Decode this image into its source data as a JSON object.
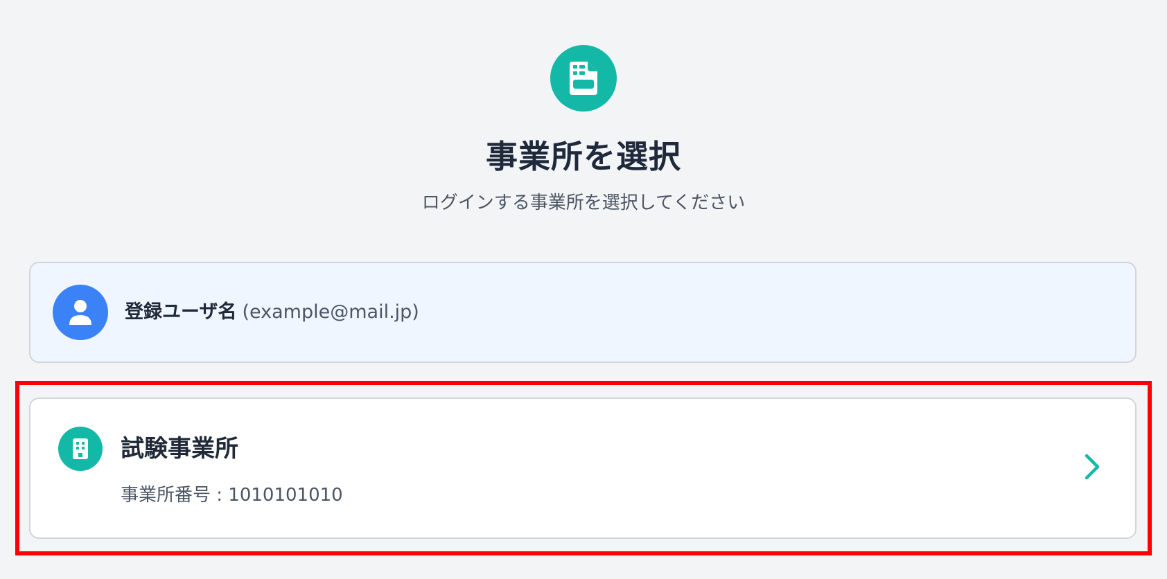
{
  "header": {
    "logo_icon": "document-icon",
    "title": "事業所を選択",
    "subtitle": "ログインする事業所を選択してください"
  },
  "user": {
    "avatar_icon": "user-icon",
    "name": "登録ユーザ名",
    "email": "(example@mail.jp)"
  },
  "offices": [
    {
      "icon": "building-icon",
      "name": "試験事業所",
      "number_label": "事業所番号 : 1010101010"
    }
  ],
  "colors": {
    "accent": "#14b8a6",
    "avatar": "#3b82f6",
    "highlight": "#ff0000",
    "background": "#f3f4f6",
    "user_card_bg": "#eff6ff"
  }
}
